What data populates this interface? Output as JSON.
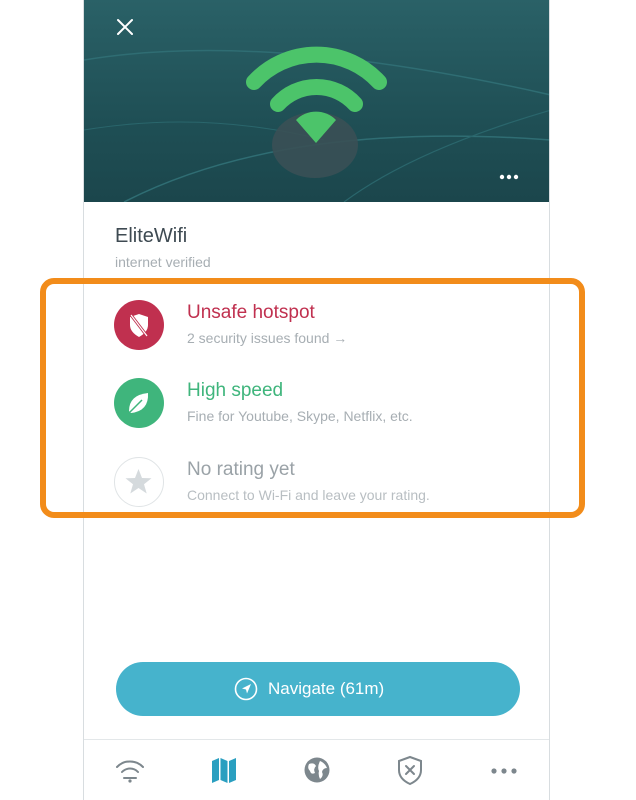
{
  "hero": {
    "close_icon": "close-icon",
    "more_icon": "more-dots-icon",
    "art_icon": "wifi-icon",
    "colors": {
      "background": "#225a60",
      "wifi": "#4cc46a"
    }
  },
  "network": {
    "name": "EliteWifi",
    "status": "internet verified"
  },
  "ratings": [
    {
      "title": "Unsafe hotspot",
      "detail": "2 security issues found →",
      "icon": "shield-off-icon",
      "color": "#c0304f"
    },
    {
      "title": "High speed",
      "detail": "Fine for Youtube, Skype, Netflix, etc.",
      "icon": "leaf-icon",
      "color": "#3fb57c"
    },
    {
      "title": "No rating yet",
      "detail": "Connect to Wi-Fi and leave your rating.",
      "icon": "star-icon",
      "color": "#9aa2a7"
    }
  ],
  "highlight_color": "#f28c1a",
  "navigate": {
    "label": "Navigate (61m)",
    "icon": "navigation-arrow-icon",
    "color": "#46b3cc"
  },
  "tabbar": [
    {
      "name": "wifi",
      "icon": "wifi-icon"
    },
    {
      "name": "map",
      "icon": "map-icon",
      "active": true
    },
    {
      "name": "globe",
      "icon": "globe-icon"
    },
    {
      "name": "security",
      "icon": "shield-x-icon"
    },
    {
      "name": "more",
      "icon": "more-dots-icon"
    }
  ]
}
